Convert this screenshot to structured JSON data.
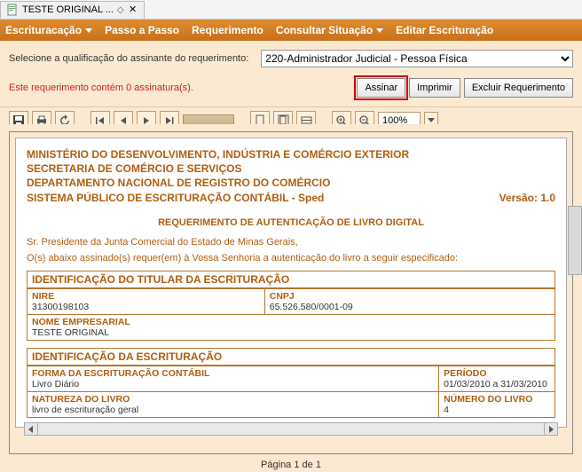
{
  "tab": {
    "title": "TESTE ORIGINAL ..."
  },
  "menu": {
    "escrituracao": "Escrituracação",
    "passo": "Passo a Passo",
    "requerimento": "Requerimento",
    "consultar": "Consultar Situação",
    "editar": "Editar Escrituração"
  },
  "select_row": {
    "label": "Selecione a qualificação do assinante do requerimento:",
    "value": "220-Administrador Judicial - Pessoa Física"
  },
  "status": "Este requerimento contém 0 assinatura(s).",
  "buttons": {
    "assinar": "Assinar",
    "imprimir": "Imprimir",
    "excluir": "Excluir Requerimento"
  },
  "zoom": "100%",
  "doc": {
    "h1": "MINISTÉRIO DO DESENVOLVIMENTO, INDÚSTRIA E COMÉRCIO EXTERIOR",
    "h2": "SECRETARIA DE COMÉRCIO E SERVIÇOS",
    "h3": "DEPARTAMENTO NACIONAL DE REGISTRO DO COMÉRCIO",
    "h4": "SISTEMA PÚBLICO DE ESCRITURAÇÃO CONTÁBIL - Sped",
    "version": "Versão: 1.0",
    "title": "REQUERIMENTO DE AUTENTICAÇÃO DE LIVRO DIGITAL",
    "p1": "Sr. Presidente da Junta Comercial do Estado de Minas Gerais,",
    "p2": "O(s) abaixo assinado(s) requer(em) à Vossa Senhoria a autenticação do livro a seguir especificado:",
    "sec1": "IDENTIFICAÇÃO DO TITULAR DA ESCRITURAÇÃO",
    "nire_label": "NIRE",
    "nire_value": "31300198103",
    "cnpj_label": "CNPJ",
    "cnpj_value": "65.526.580/0001-09",
    "nome_label": "NOME EMPRESARIAL",
    "nome_value": "TESTE ORIGINAL",
    "sec2": "IDENTIFICAÇÃO DA ESCRITURAÇÃO",
    "forma_label": "FORMA DA ESCRITURAÇÃO CONTÁBIL",
    "forma_value": "Livro Diário",
    "periodo_label": "PERÍODO",
    "periodo_value": "01/03/2010 a 31/03/2010",
    "natureza_label": "NATUREZA DO LIVRO",
    "natureza_value": "livro de escrituração geral",
    "numero_label": "NÚMERO DO LIVRO",
    "numero_value": "4"
  },
  "footer": "Página 1 de 1"
}
